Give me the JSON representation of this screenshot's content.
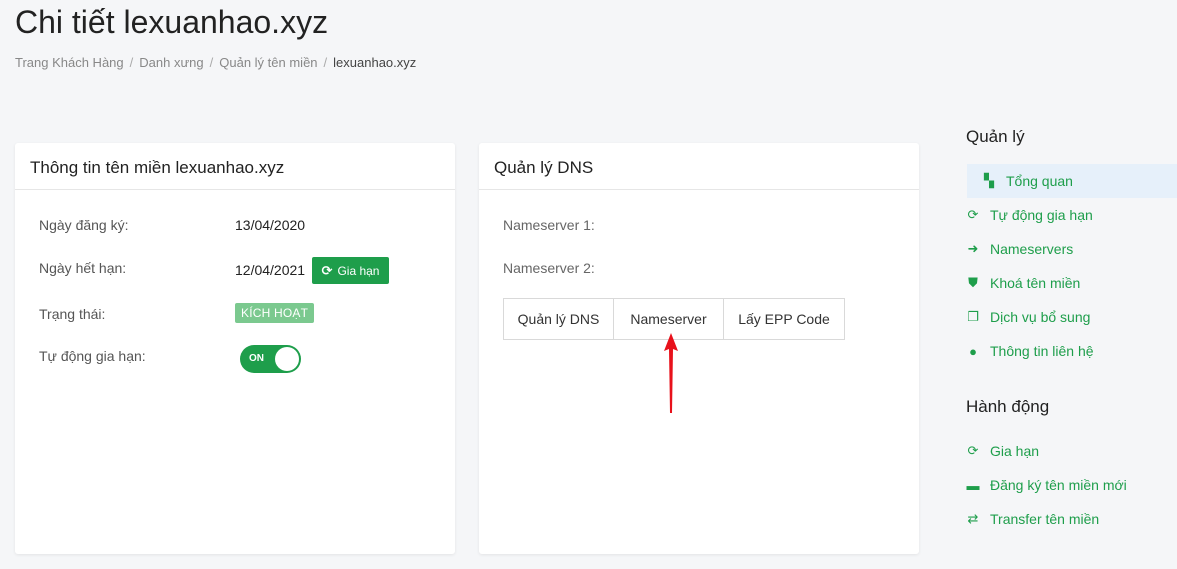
{
  "page": {
    "title": "Chi tiết lexuanhao.xyz"
  },
  "breadcrumb": [
    "Trang Khách Hàng",
    "Danh xưng",
    "Quản lý tên miền",
    "lexuanhao.xyz"
  ],
  "info_card": {
    "title": "Thông tin tên miền lexuanhao.xyz",
    "reg_label": "Ngày đăng ký:",
    "reg_value": "13/04/2020",
    "exp_label": "Ngày hết hạn:",
    "exp_value": "12/04/2021",
    "renew_button": "Gia hạn",
    "status_label": "Trạng thái:",
    "status_value": "KÍCH HOẠT",
    "autorenew_label": "Tự động gia hạn:",
    "toggle_text": "ON"
  },
  "dns_card": {
    "title": "Quản lý DNS",
    "ns1_label": "Nameserver 1:",
    "ns2_label": "Nameserver 2:",
    "tabs": [
      "Quản lý DNS",
      "Nameserver",
      "Lấy EPP Code"
    ]
  },
  "sidebar": {
    "manage_heading": "Quản lý",
    "manage_items": [
      {
        "label": "Tổng quan",
        "icon": "dashboard-icon"
      },
      {
        "label": "Tự động gia hạn",
        "icon": "sync-icon"
      },
      {
        "label": "Nameservers",
        "icon": "arrow-right-icon"
      },
      {
        "label": "Khoá tên miền",
        "icon": "shield-icon"
      },
      {
        "label": "Dịch vụ bổ sung",
        "icon": "clone-icon"
      },
      {
        "label": "Thông tin liên hệ",
        "icon": "user-icon"
      }
    ],
    "actions_heading": "Hành động",
    "action_items": [
      {
        "label": "Gia hạn",
        "icon": "sync-icon"
      },
      {
        "label": "Đăng ký tên miền mới",
        "icon": "tag-icon"
      },
      {
        "label": "Transfer tên miền",
        "icon": "exchange-icon"
      }
    ]
  },
  "colors": {
    "accent": "#1e9e4b",
    "status_badge": "#7bc98f",
    "active_bg": "#e6f0fa",
    "annotation_arrow": "#e8111b"
  }
}
